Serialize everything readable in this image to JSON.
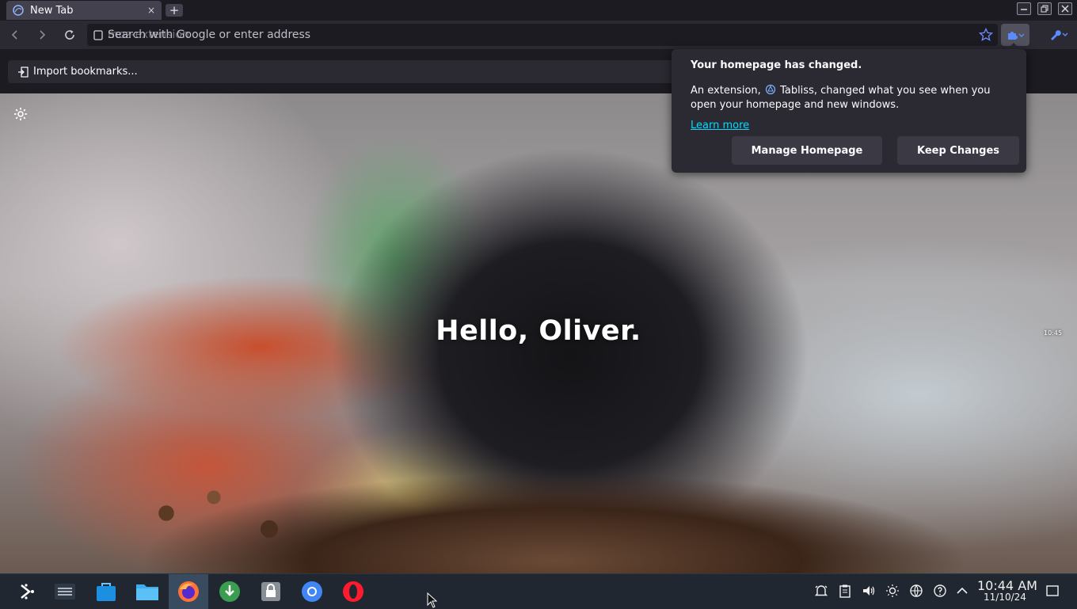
{
  "browser": {
    "tab_title": "New Tab",
    "tab_close": "×",
    "new_tab": "+",
    "url_placeholder": "Search with Google or enter address",
    "url_prefix": "moz-extension",
    "window_buttons": [
      "minimize",
      "restore",
      "close"
    ]
  },
  "bookmarks": {
    "import_label": "Import bookmarks..."
  },
  "page": {
    "greeting": "Hello, Oliver.",
    "mini_clock": "10:45"
  },
  "popup": {
    "title": "Your homepage has changed.",
    "body_before": "An extension,",
    "extension_name": "Tabliss",
    "body_after": ", changed what you see when you open your homepage and new windows.",
    "learn_more": "Learn more",
    "manage_button": "Manage Homepage",
    "keep_button": "Keep Changes"
  },
  "taskbar": {
    "apps": [
      "kde-launcher",
      "system-settings",
      "discover-store",
      "file-manager",
      "firefox",
      "download-manager",
      "vault-lock",
      "chromium",
      "opera"
    ],
    "active_app": "firefox",
    "tray": [
      "notifications-icon",
      "clipboard-icon",
      "volume-icon",
      "brightness-icon",
      "network-icon",
      "help-icon",
      "expand-tray-icon"
    ],
    "time": "10:44 AM",
    "date": "11/10/24"
  },
  "colors": {
    "accent": "#00ddff",
    "toolbar": "#2b2a33",
    "frame": "#1c1b22",
    "taskbar": "#202730"
  }
}
